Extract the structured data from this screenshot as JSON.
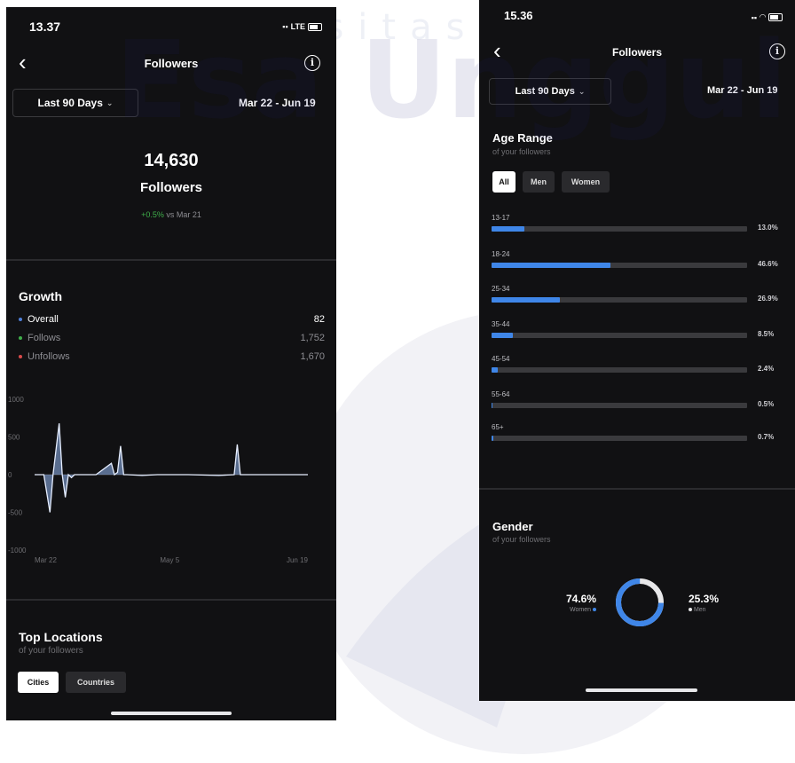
{
  "watermark": {
    "line1": "Universitas",
    "line2": "Esa Unggul"
  },
  "left_screen": {
    "status": {
      "time": "13.37",
      "network": "LTE"
    },
    "nav": {
      "back": "‹",
      "title": "Followers",
      "info_icon": "i"
    },
    "date_range": {
      "label": "Last 90 Days",
      "chevron": "⌄",
      "dates": "Mar 22 - Jun 19"
    },
    "summary": {
      "count": "14,630",
      "label": "Followers",
      "change": "+0.5%",
      "change_suffix": " vs Mar 21",
      "change_color": "#3fae4a"
    },
    "growth": {
      "title": "Growth",
      "legend": [
        {
          "label": "Overall",
          "value": "82",
          "color": "#4f7fd8"
        },
        {
          "label": "Follows",
          "value": "1,752",
          "color": "#3fae4a"
        },
        {
          "label": "Unfollows",
          "value": "1,670",
          "color": "#d84a4a"
        }
      ]
    },
    "top_locations": {
      "title": "Top Locations",
      "subtitle": "of your followers",
      "tabs": [
        "Cities",
        "Countries"
      ]
    }
  },
  "chart_data": {
    "type": "area",
    "title": "",
    "xlabel": "",
    "ylabel": "",
    "ylim": [
      -1000,
      1000
    ],
    "yticks": [
      "1000",
      "500",
      "0",
      "-500",
      "-1000"
    ],
    "xticks": [
      "Mar 22",
      "May 5",
      "Jun 19"
    ],
    "grid": false,
    "series": [
      {
        "name": "Overall",
        "x": [
          0,
          3,
          5,
          6,
          8,
          9,
          10,
          11,
          12,
          13,
          16,
          20,
          25,
          26,
          27,
          28,
          29,
          30,
          35,
          40,
          50,
          60,
          65,
          66,
          67,
          70,
          80,
          89
        ],
        "values": [
          0,
          0,
          -500,
          0,
          680,
          0,
          -300,
          0,
          -40,
          0,
          0,
          0,
          150,
          0,
          30,
          380,
          0,
          0,
          -10,
          0,
          0,
          -10,
          0,
          400,
          0,
          0,
          0,
          0
        ]
      }
    ]
  },
  "right_screen": {
    "status": {
      "time": "15.36"
    },
    "nav": {
      "back": "‹",
      "title": "Followers",
      "info_icon": "i"
    },
    "date_range": {
      "label": "Last 90 Days",
      "chevron": "⌄",
      "dates": "Mar 22 - Jun 19"
    },
    "age": {
      "title": "Age Range",
      "subtitle": "of your followers",
      "tabs": [
        "All",
        "Men",
        "Women"
      ],
      "rows": [
        {
          "label": "13-17",
          "value": "13.0%",
          "pct": 13.0
        },
        {
          "label": "18-24",
          "value": "46.6%",
          "pct": 46.6
        },
        {
          "label": "25-34",
          "value": "26.9%",
          "pct": 26.9
        },
        {
          "label": "35-44",
          "value": "8.5%",
          "pct": 8.5
        },
        {
          "label": "45-54",
          "value": "2.4%",
          "pct": 2.4
        },
        {
          "label": "55-64",
          "value": "0.5%",
          "pct": 0.5
        },
        {
          "label": "65+",
          "value": "0.7%",
          "pct": 0.7
        }
      ]
    },
    "gender": {
      "title": "Gender",
      "subtitle": "of your followers",
      "women_pct": "74.6%",
      "women_label": "Women",
      "men_pct": "25.3%",
      "men_label": "Men",
      "women_share": 74.6,
      "women_color": "#3f86e8",
      "men_color": "#e8e8ea"
    }
  }
}
